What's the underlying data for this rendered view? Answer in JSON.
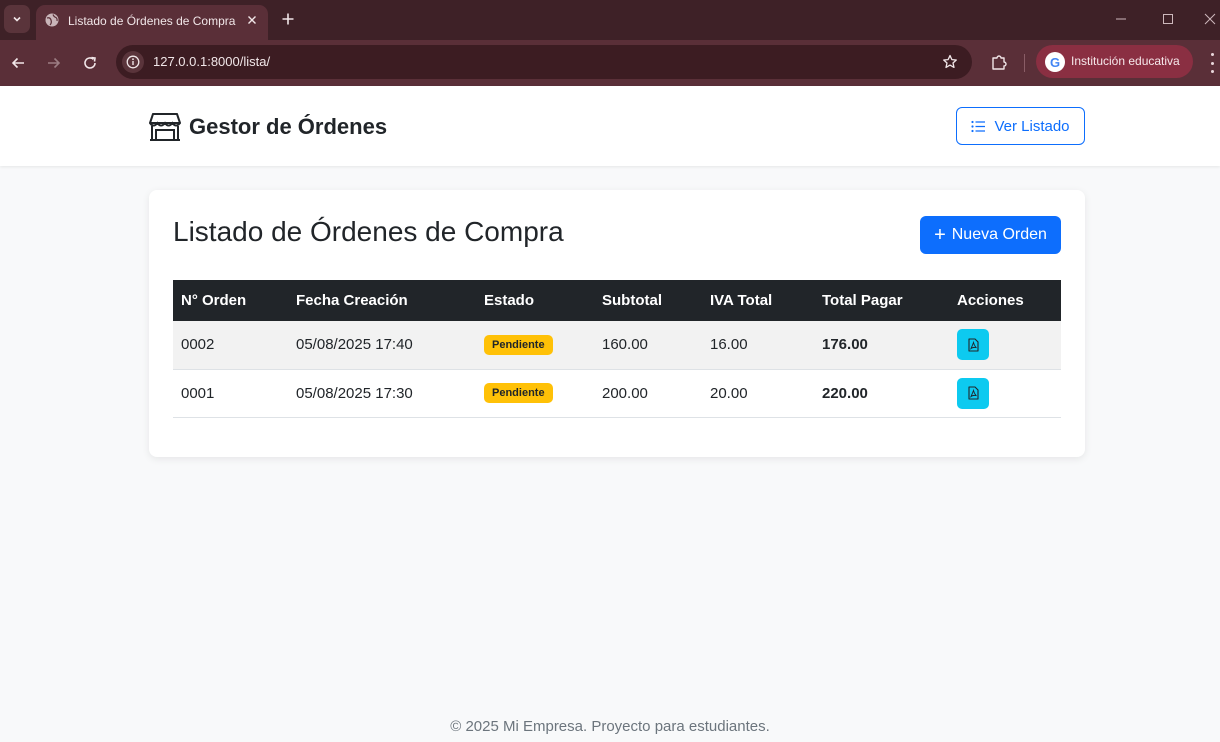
{
  "browser": {
    "tab_title": "Listado de Órdenes de Compra",
    "url": "127.0.0.1:8000/lista/",
    "profile_label": "Institución educativa"
  },
  "navbar": {
    "brand": "Gestor de Órdenes",
    "list_button": "Ver Listado"
  },
  "main": {
    "title": "Listado de Órdenes de Compra",
    "new_order_button": "Nueva Orden",
    "table": {
      "headers": [
        "N° Orden",
        "Fecha Creación",
        "Estado",
        "Subtotal",
        "IVA Total",
        "Total Pagar",
        "Acciones"
      ],
      "rows": [
        {
          "orden": "0002",
          "fecha": "05/08/2025 17:40",
          "estado": "Pendiente",
          "subtotal": "160.00",
          "iva": "16.00",
          "total": "176.00"
        },
        {
          "orden": "0001",
          "fecha": "05/08/2025 17:30",
          "estado": "Pendiente",
          "subtotal": "200.00",
          "iva": "20.00",
          "total": "220.00"
        }
      ]
    }
  },
  "footer": {
    "text": "© 2025 Mi Empresa. Proyecto para estudiantes."
  },
  "colors": {
    "primary": "#0d6efd",
    "warning": "#ffc107",
    "info": "#0dcaf0",
    "dark": "#212529",
    "chrome": "#5a2f38"
  }
}
